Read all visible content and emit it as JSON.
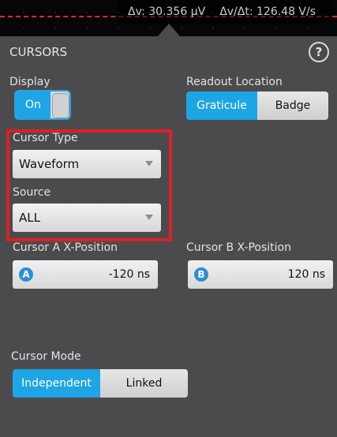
{
  "readout": {
    "delta_v": "Δv: 30.356 µV",
    "delta_v_per_t": "Δv/Δt: 126.48 V/s"
  },
  "panel": {
    "title": "CURSORS",
    "help_icon": "?"
  },
  "display": {
    "label": "Display",
    "toggle_label": "On",
    "state": "on"
  },
  "readout_location": {
    "label": "Readout Location",
    "options": [
      "Graticule",
      "Badge"
    ],
    "selected": "Graticule"
  },
  "cursor_type": {
    "label": "Cursor Type",
    "value": "Waveform"
  },
  "source": {
    "label": "Source",
    "value": "ALL"
  },
  "cursor_a": {
    "label": "Cursor A X-Position",
    "badge": "A",
    "value": "-120 ns"
  },
  "cursor_b": {
    "label": "Cursor B X-Position",
    "badge": "B",
    "value": "120 ns"
  },
  "cursor_mode": {
    "label": "Cursor Mode",
    "options": [
      "Independent",
      "Linked"
    ],
    "selected": "Independent"
  },
  "colors": {
    "accent": "#1ea5e6",
    "highlight": "#e01e25",
    "panel_bg": "#4b4b4d",
    "cursor_line": "#d8282e"
  }
}
